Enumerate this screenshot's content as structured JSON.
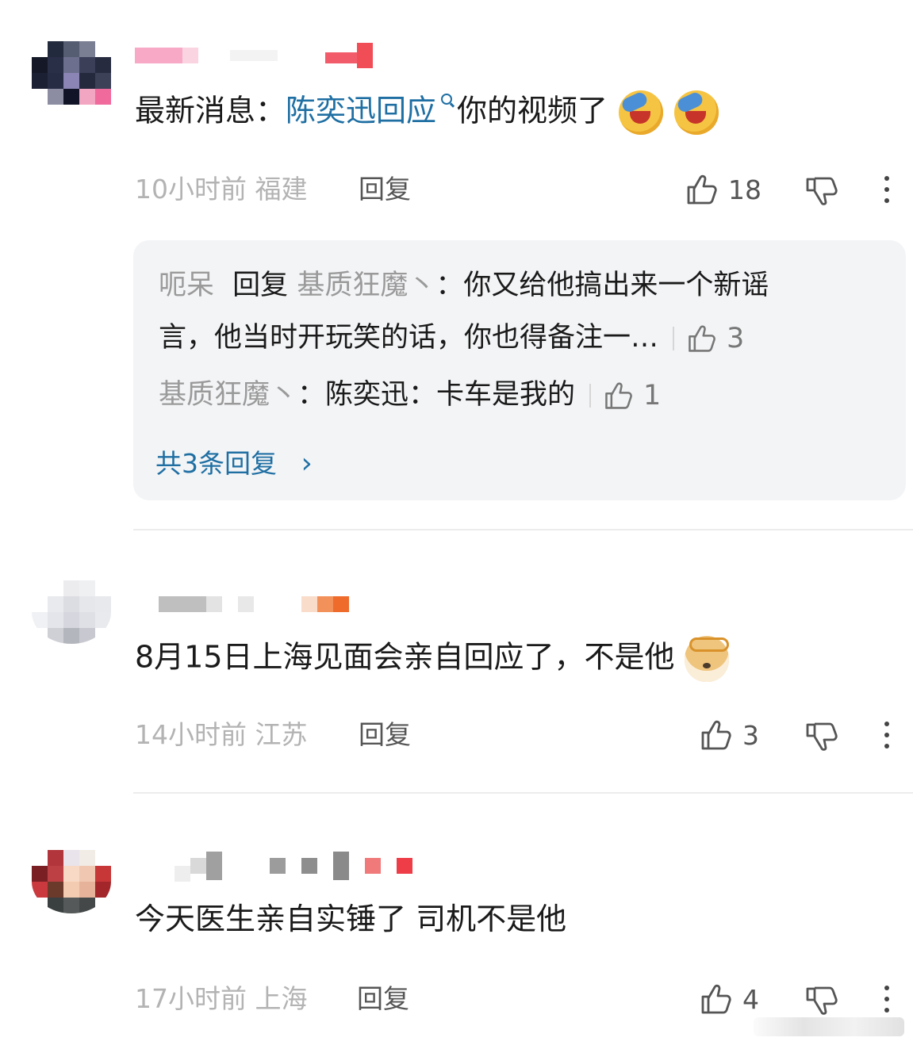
{
  "comments": [
    {
      "text_plain": "最新消息：",
      "text_link": "陈奕迅回应",
      "text_after": "你的视频了",
      "time": "10小时前",
      "location": "福建",
      "reply_label": "回复",
      "like_count": "18",
      "replies": [
        {
          "author": "呃呆",
          "reply_word": "回复",
          "target": "基质狂魔丶",
          "text_line1": "：你又给他搞出来一个新谣",
          "text_line2": "言，他当时开玩笑的话，你也得备注一…",
          "likes": "3"
        },
        {
          "author": "基质狂魔丶",
          "text": "：陈奕迅：卡车是我的",
          "likes": "1"
        }
      ],
      "total_replies": "共3条回复",
      "total_arrow": "›"
    },
    {
      "text": "8月15日上海见面会亲自回应了，不是他",
      "time": "14小时前",
      "location": "江苏",
      "reply_label": "回复",
      "like_count": "3"
    },
    {
      "text": "今天医生亲自实锤了 司机不是他",
      "time": "17小时前",
      "location": "上海",
      "reply_label": "回复",
      "like_count": "4"
    }
  ]
}
